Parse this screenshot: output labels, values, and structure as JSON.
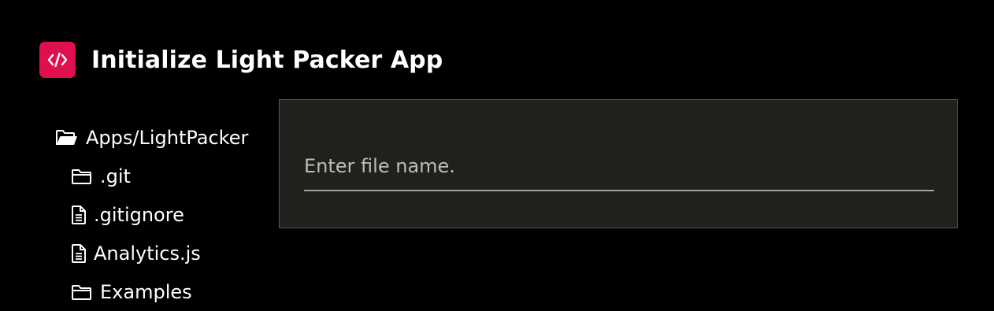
{
  "app": {
    "title": "Initialize Light Packer App",
    "logo_icon": "code-icon",
    "logo_color": "#e0104f"
  },
  "file_tree": {
    "root": {
      "label": "Apps/LightPacker",
      "icon": "folder-open-icon"
    },
    "children": [
      {
        "label": ".git",
        "icon": "folder-icon"
      },
      {
        "label": ".gitignore",
        "icon": "file-text-icon"
      },
      {
        "label": "Analytics.js",
        "icon": "file-text-icon"
      },
      {
        "label": "Examples",
        "icon": "folder-icon"
      }
    ]
  },
  "file_input": {
    "value": "",
    "placeholder": "Enter file name."
  },
  "colors": {
    "background": "#000000",
    "panel_background": "#20201c",
    "panel_border": "#4c5862"
  }
}
